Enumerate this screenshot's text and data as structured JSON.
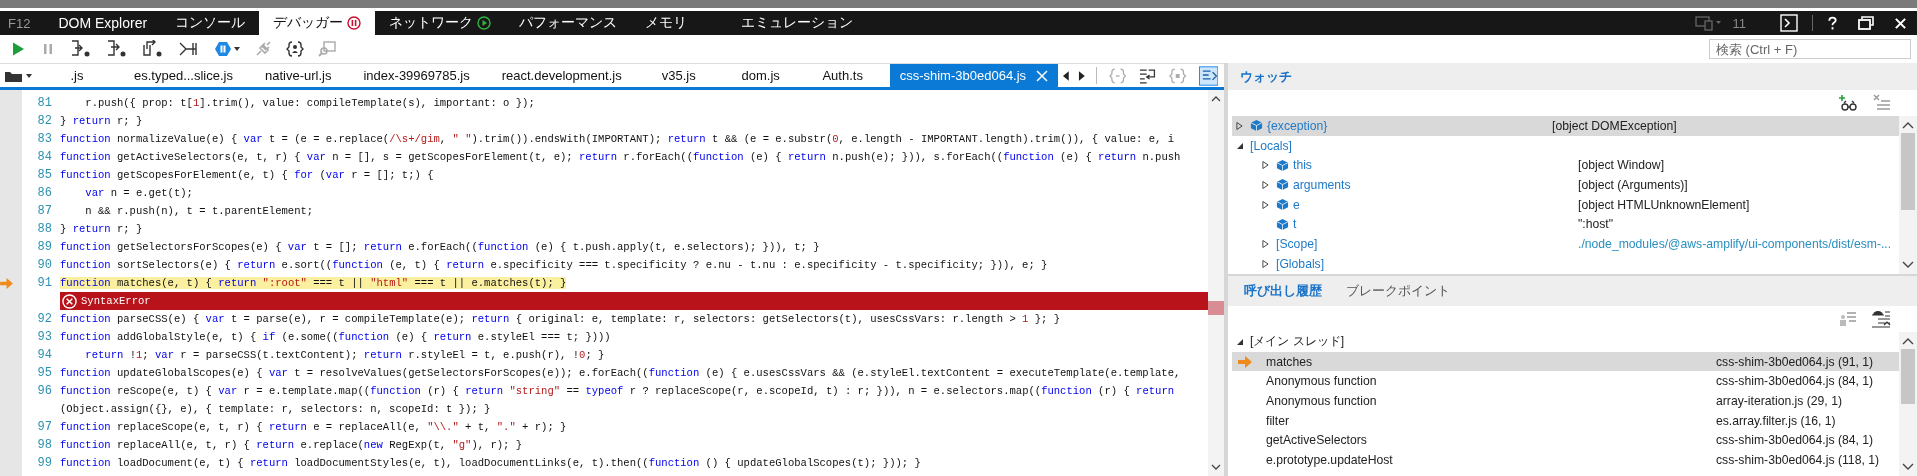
{
  "app_label": "F12",
  "tabs": [
    {
      "label": "DOM Explorer",
      "selected": false,
      "kind": "plain"
    },
    {
      "label": "コンソール",
      "selected": false,
      "kind": "plain"
    },
    {
      "label": "デバッガー",
      "selected": true,
      "kind": "paused"
    },
    {
      "label": "ネットワーク",
      "selected": false,
      "kind": "recording"
    },
    {
      "label": "パフォーマンス",
      "selected": false,
      "kind": "plain"
    },
    {
      "label": "メモリ",
      "selected": false,
      "kind": "plain"
    },
    {
      "label": "エミュレーション",
      "selected": false,
      "kind": "plain"
    }
  ],
  "document_mode": "11",
  "search": {
    "placeholder": "検索 (Ctrl + F)"
  },
  "file_tabs": [
    {
      "label": ".js",
      "selected": false
    },
    {
      "label": "es.typed...slice.js",
      "selected": false
    },
    {
      "label": "native-url.js",
      "selected": false
    },
    {
      "label": "index-39969785.js",
      "selected": false
    },
    {
      "label": "react.development.js",
      "selected": false
    },
    {
      "label": "v35.js",
      "selected": false
    },
    {
      "label": "dom.js",
      "selected": false
    },
    {
      "label": "Auth.ts",
      "selected": false
    },
    {
      "label": "css-shim-3b0ed064.js",
      "selected": true
    }
  ],
  "code": [
    {
      "kind": "code",
      "number": "81",
      "indented": true,
      "current": false,
      "segments": [
        {
          "kind": "plain",
          "text": "r.push({ prop: t["
        },
        {
          "kind": "literal",
          "text": "1"
        },
        {
          "kind": "plain",
          "text": "].trim(), value: compileTemplate(s), important: o });"
        }
      ]
    },
    {
      "kind": "code",
      "number": "82",
      "indented": false,
      "current": false,
      "segments": [
        {
          "kind": "plain",
          "text": "} "
        },
        {
          "kind": "keyword",
          "text": "return"
        },
        {
          "kind": "plain",
          "text": " r; }"
        }
      ]
    },
    {
      "kind": "code",
      "number": "83",
      "indented": false,
      "current": false,
      "segments": [
        {
          "kind": "keyword",
          "text": "function"
        },
        {
          "kind": "plain",
          "text": " normalizeValue(e) { "
        },
        {
          "kind": "keyword",
          "text": "var"
        },
        {
          "kind": "plain",
          "text": " t = (e = e.replace("
        },
        {
          "kind": "literal",
          "text": "/\\s+/gim"
        },
        {
          "kind": "plain",
          "text": ", "
        },
        {
          "kind": "literal",
          "text": "\" \""
        },
        {
          "kind": "plain",
          "text": ").trim()).endsWith(IMPORTANT); "
        },
        {
          "kind": "keyword",
          "text": "return"
        },
        {
          "kind": "plain",
          "text": " t && (e = e.substr("
        },
        {
          "kind": "literal",
          "text": "0"
        },
        {
          "kind": "plain",
          "text": ", e.length - IMPORTANT.length).trim()), { value: e, i"
        }
      ]
    },
    {
      "kind": "code",
      "number": "84",
      "indented": false,
      "current": false,
      "segments": [
        {
          "kind": "keyword",
          "text": "function"
        },
        {
          "kind": "plain",
          "text": " getActiveSelectors(e, t, r) { "
        },
        {
          "kind": "keyword",
          "text": "var"
        },
        {
          "kind": "plain",
          "text": " n = [], s = getScopesForElement(t, e); "
        },
        {
          "kind": "keyword",
          "text": "return"
        },
        {
          "kind": "plain",
          "text": " r.forEach(("
        },
        {
          "kind": "keyword",
          "text": "function"
        },
        {
          "kind": "plain",
          "text": " (e) { "
        },
        {
          "kind": "keyword",
          "text": "return"
        },
        {
          "kind": "plain",
          "text": " n.push(e); })), s.forEach(("
        },
        {
          "kind": "keyword",
          "text": "function"
        },
        {
          "kind": "plain",
          "text": " (e) { "
        },
        {
          "kind": "keyword",
          "text": "return"
        },
        {
          "kind": "plain",
          "text": " n.push"
        }
      ]
    },
    {
      "kind": "code",
      "number": "85",
      "indented": false,
      "current": false,
      "segments": [
        {
          "kind": "keyword",
          "text": "function"
        },
        {
          "kind": "plain",
          "text": " getScopesForElement(e, t) { "
        },
        {
          "kind": "keyword",
          "text": "for"
        },
        {
          "kind": "plain",
          "text": " ("
        },
        {
          "kind": "keyword",
          "text": "var"
        },
        {
          "kind": "plain",
          "text": " r = []; t;) {"
        }
      ]
    },
    {
      "kind": "code",
      "number": "86",
      "indented": true,
      "current": false,
      "segments": [
        {
          "kind": "keyword",
          "text": "var"
        },
        {
          "kind": "plain",
          "text": " n = e.get(t);"
        }
      ]
    },
    {
      "kind": "code",
      "number": "87",
      "indented": true,
      "current": false,
      "segments": [
        {
          "kind": "plain",
          "text": "n && r.push(n), t = t.parentElement;"
        }
      ]
    },
    {
      "kind": "code",
      "number": "88",
      "indented": false,
      "current": false,
      "segments": [
        {
          "kind": "plain",
          "text": "} "
        },
        {
          "kind": "keyword",
          "text": "return"
        },
        {
          "kind": "plain",
          "text": " r; }"
        }
      ]
    },
    {
      "kind": "code",
      "number": "89",
      "indented": false,
      "current": false,
      "segments": [
        {
          "kind": "keyword",
          "text": "function"
        },
        {
          "kind": "plain",
          "text": " getSelectorsForScopes(e) { "
        },
        {
          "kind": "keyword",
          "text": "var"
        },
        {
          "kind": "plain",
          "text": " t = []; "
        },
        {
          "kind": "keyword",
          "text": "return"
        },
        {
          "kind": "plain",
          "text": " e.forEach(("
        },
        {
          "kind": "keyword",
          "text": "function"
        },
        {
          "kind": "plain",
          "text": " (e) { t.push.apply(t, e.selectors); })), t; }"
        }
      ]
    },
    {
      "kind": "code",
      "number": "90",
      "indented": false,
      "current": false,
      "segments": [
        {
          "kind": "keyword",
          "text": "function"
        },
        {
          "kind": "plain",
          "text": " sortSelectors(e) { "
        },
        {
          "kind": "keyword",
          "text": "return"
        },
        {
          "kind": "plain",
          "text": " e.sort(("
        },
        {
          "kind": "keyword",
          "text": "function"
        },
        {
          "kind": "plain",
          "text": " (e, t) { "
        },
        {
          "kind": "keyword",
          "text": "return"
        },
        {
          "kind": "plain",
          "text": " e.specificity === t.specificity ? e.nu - t.nu : e.specificity - t.specificity; })), e; }"
        }
      ]
    },
    {
      "kind": "code",
      "number": "91",
      "indented": false,
      "current": true,
      "segments": [
        {
          "kind": "keyword",
          "text": "function"
        },
        {
          "kind": "plain",
          "text": " matches(e, t) { "
        },
        {
          "kind": "keyword",
          "text": "return"
        },
        {
          "kind": "literal",
          "text": " \":root\""
        },
        {
          "kind": "plain",
          "text": " === t || "
        },
        {
          "kind": "literal",
          "text": "\"html\""
        },
        {
          "kind": "plain",
          "text": " === t || e.matches(t); }"
        }
      ]
    },
    {
      "kind": "error",
      "text": "SyntaxError"
    },
    {
      "kind": "code",
      "number": "92",
      "indented": false,
      "current": false,
      "segments": [
        {
          "kind": "keyword",
          "text": "function"
        },
        {
          "kind": "plain",
          "text": " parseCSS(e) { "
        },
        {
          "kind": "keyword",
          "text": "var"
        },
        {
          "kind": "plain",
          "text": " t = parse(e), r = compileTemplate(e); "
        },
        {
          "kind": "keyword",
          "text": "return"
        },
        {
          "kind": "plain",
          "text": " { original: e, template: r, selectors: getSelectors(t), usesCssVars: r.length > "
        },
        {
          "kind": "literal",
          "text": "1"
        },
        {
          "kind": "plain",
          "text": " }; }"
        }
      ]
    },
    {
      "kind": "code",
      "number": "93",
      "indented": false,
      "current": false,
      "segments": [
        {
          "kind": "keyword",
          "text": "function"
        },
        {
          "kind": "plain",
          "text": " addGlobalStyle(e, t) { "
        },
        {
          "kind": "keyword",
          "text": "if"
        },
        {
          "kind": "plain",
          "text": " (e.some(("
        },
        {
          "kind": "keyword",
          "text": "function"
        },
        {
          "kind": "plain",
          "text": " (e) { "
        },
        {
          "kind": "keyword",
          "text": "return"
        },
        {
          "kind": "plain",
          "text": " e.styleEl === t; })))"
        }
      ]
    },
    {
      "kind": "code",
      "number": "94",
      "indented": true,
      "current": false,
      "segments": [
        {
          "kind": "keyword",
          "text": "return"
        },
        {
          "kind": "plain",
          "text": " !"
        },
        {
          "kind": "literal",
          "text": "1"
        },
        {
          "kind": "plain",
          "text": "; "
        },
        {
          "kind": "keyword",
          "text": "var"
        },
        {
          "kind": "plain",
          "text": " r = parseCSS(t.textContent); "
        },
        {
          "kind": "keyword",
          "text": "return"
        },
        {
          "kind": "plain",
          "text": " r.styleEl = t, e.push(r), !"
        },
        {
          "kind": "literal",
          "text": "0"
        },
        {
          "kind": "plain",
          "text": "; }"
        }
      ]
    },
    {
      "kind": "code",
      "number": "95",
      "indented": false,
      "current": false,
      "segments": [
        {
          "kind": "keyword",
          "text": "function"
        },
        {
          "kind": "plain",
          "text": " updateGlobalScopes(e) { "
        },
        {
          "kind": "keyword",
          "text": "var"
        },
        {
          "kind": "plain",
          "text": " t = resolveValues(getSelectorsForScopes(e)); e.forEach(("
        },
        {
          "kind": "keyword",
          "text": "function"
        },
        {
          "kind": "plain",
          "text": " (e) { e.usesCssVars && (e.styleEl.textContent = executeTemplate(e.template,"
        }
      ]
    },
    {
      "kind": "code",
      "number": "96",
      "indented": false,
      "current": false,
      "segments": [
        {
          "kind": "keyword",
          "text": "function"
        },
        {
          "kind": "plain",
          "text": " reScope(e, t) { "
        },
        {
          "kind": "keyword",
          "text": "var"
        },
        {
          "kind": "plain",
          "text": " r = e.template.map(("
        },
        {
          "kind": "keyword",
          "text": "function"
        },
        {
          "kind": "plain",
          "text": " (r) { "
        },
        {
          "kind": "keyword",
          "text": "return"
        },
        {
          "kind": "literal",
          "text": " \"string\""
        },
        {
          "kind": "plain",
          "text": " == "
        },
        {
          "kind": "keyword",
          "text": "typeof"
        },
        {
          "kind": "plain",
          "text": " r ? replaceScope(r, e.scopeId, t) : r; })), n = e.selectors.map(("
        },
        {
          "kind": "keyword",
          "text": "function"
        },
        {
          "kind": "plain",
          "text": " (r) { "
        },
        {
          "kind": "keyword",
          "text": "return"
        }
      ]
    },
    {
      "kind": "code",
      "indented": false,
      "current": false,
      "segments": [
        {
          "kind": "plain",
          "text": "(Object.assign({}, e), { template: r, selectors: n, scopeId: t }); }"
        }
      ]
    },
    {
      "kind": "code",
      "number": "97",
      "indented": false,
      "current": false,
      "segments": [
        {
          "kind": "keyword",
          "text": "function"
        },
        {
          "kind": "plain",
          "text": " replaceScope(e, t, r) { "
        },
        {
          "kind": "keyword",
          "text": "return"
        },
        {
          "kind": "plain",
          "text": " e = replaceAll(e, "
        },
        {
          "kind": "literal",
          "text": "\"\\\\.\""
        },
        {
          "kind": "plain",
          "text": " + t, "
        },
        {
          "kind": "literal",
          "text": "\".\""
        },
        {
          "kind": "plain",
          "text": " + r); }"
        }
      ]
    },
    {
      "kind": "code",
      "number": "98",
      "indented": false,
      "current": false,
      "segments": [
        {
          "kind": "keyword",
          "text": "function"
        },
        {
          "kind": "plain",
          "text": " replaceAll(e, t, r) { "
        },
        {
          "kind": "keyword",
          "text": "return"
        },
        {
          "kind": "plain",
          "text": " e.replace("
        },
        {
          "kind": "keyword",
          "text": "new"
        },
        {
          "kind": "plain",
          "text": " RegExp(t, "
        },
        {
          "kind": "literal",
          "text": "\"g\""
        },
        {
          "kind": "plain",
          "text": "), r); }"
        }
      ]
    },
    {
      "kind": "code",
      "number": "99",
      "indented": false,
      "current": false,
      "segments": [
        {
          "kind": "keyword",
          "text": "function"
        },
        {
          "kind": "plain",
          "text": " loadDocument(e, t) { "
        },
        {
          "kind": "keyword",
          "text": "return"
        },
        {
          "kind": "plain",
          "text": " loadDocumentStyles(e, t), loadDocumentLinks(e, t).then(("
        },
        {
          "kind": "keyword",
          "text": "function"
        },
        {
          "kind": "plain",
          "text": " () { updateGlobalScopes(t); })); }"
        }
      ]
    }
  ],
  "watch": {
    "title": "ウォッチ",
    "items": [
      {
        "name": "{exception}",
        "value": "[object DOMException]",
        "kind": "variable",
        "expanded": false,
        "selected": true
      },
      {
        "name": "[Locals]",
        "kind": "group",
        "expanded": true,
        "selected": false,
        "children": [
          {
            "name": "this",
            "value": "[object Window]",
            "kind": "variable",
            "expanded": false,
            "selected": false
          },
          {
            "name": "arguments",
            "value": "[object (Arguments)]",
            "kind": "variable",
            "expanded": false,
            "selected": false
          },
          {
            "name": "e",
            "value": "[object HTMLUnknownElement]",
            "kind": "variable",
            "expanded": false,
            "selected": false
          },
          {
            "name": "t",
            "value": "\":host\"",
            "kind": "variable",
            "selected": false
          },
          {
            "name": "[Scope]",
            "value": "./node_modules/@aws-amplify/ui-components/dist/esm-...",
            "kind": "group",
            "expanded": false,
            "selected": false
          },
          {
            "name": "[Globals]",
            "kind": "group",
            "expanded": false,
            "selected": false
          }
        ]
      }
    ]
  },
  "bottom_tabs": [
    {
      "label": "呼び出し履歴",
      "selected": true
    },
    {
      "label": "ブレークポイント",
      "selected": false
    }
  ],
  "call_stack": {
    "thread": "[メイン スレッド]",
    "expanded": true,
    "frames": [
      {
        "name": "matches",
        "location": "css-shim-3b0ed064.js (91, 1)",
        "current": true,
        "selected": true
      },
      {
        "name": "Anonymous function",
        "location": "css-shim-3b0ed064.js (84, 1)",
        "current": false,
        "selected": false
      },
      {
        "name": "Anonymous function",
        "location": "array-iteration.js (29, 1)",
        "current": false,
        "selected": false
      },
      {
        "name": "filter",
        "location": "es.array.filter.js (16, 1)",
        "current": false,
        "selected": false
      },
      {
        "name": "getActiveSelectors",
        "location": "css-shim-3b0ed064.js (84, 1)",
        "current": false,
        "selected": false
      },
      {
        "name": "e.prototype.updateHost",
        "location": "css-shim-3b0ed064.js (118, 1)",
        "current": false,
        "selected": false
      }
    ]
  }
}
